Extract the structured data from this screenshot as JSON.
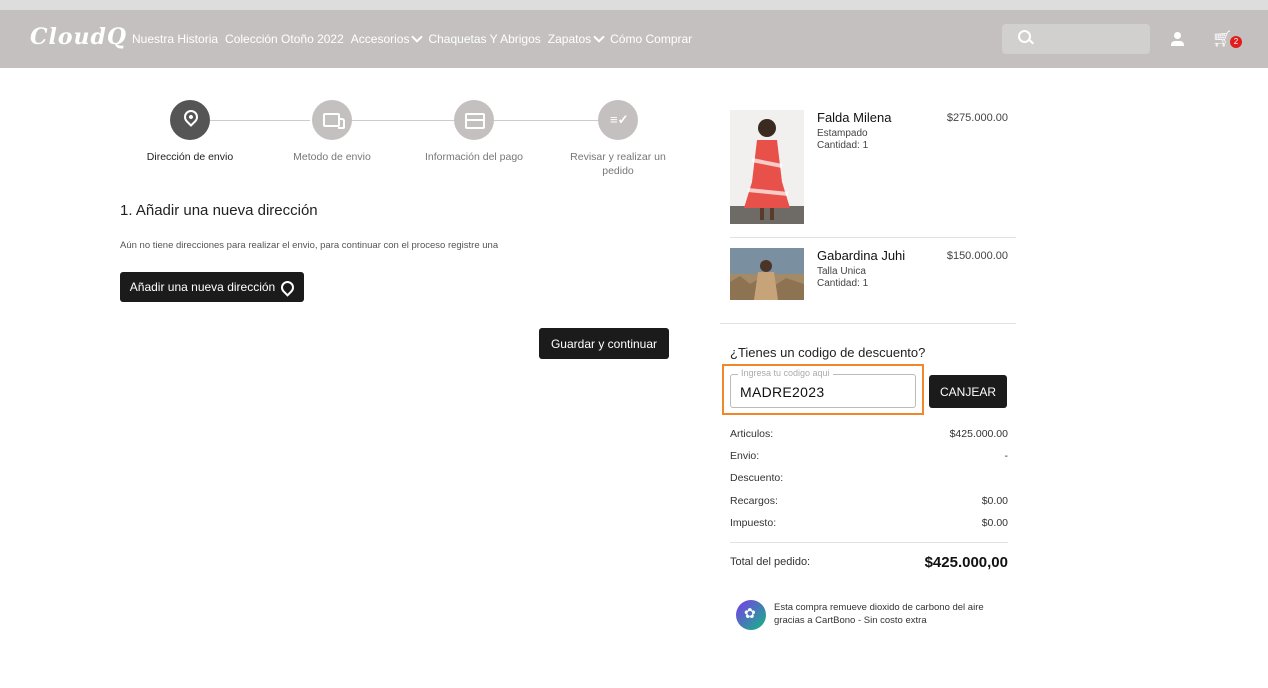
{
  "header": {
    "logo": "CloudQ",
    "nav": [
      {
        "label": "Nuestra Historia",
        "dropdown": false
      },
      {
        "label": "Colección Otoño 2022",
        "dropdown": false
      },
      {
        "label": "Accesorios",
        "dropdown": true
      },
      {
        "label": "Chaquetas Y Abrigos",
        "dropdown": false
      },
      {
        "label": "Zapatos",
        "dropdown": true
      },
      {
        "label": "Cómo Comprar",
        "dropdown": false
      }
    ],
    "cart_count": "2"
  },
  "steps": [
    {
      "label": "Dirección de envio",
      "icon": "location-pin-icon",
      "active": true
    },
    {
      "label": "Metodo de envio",
      "icon": "truck-icon",
      "active": false
    },
    {
      "label": "Información del pago",
      "icon": "credit-card-icon",
      "active": false
    },
    {
      "label": "Revisar y realizar un pedido",
      "icon": "review-list-icon",
      "active": false
    }
  ],
  "address": {
    "title": "1. Añadir una nueva dirección",
    "empty_message": "Aún no tiene direcciones para realizar el envio, para continuar con el proceso registre una",
    "add_button": "Añadir una nueva dirección",
    "save_button": "Guardar y continuar"
  },
  "cart": {
    "items": [
      {
        "name": "Falda Milena",
        "variant": "Estampado",
        "quantity": "Cantidad: 1",
        "price": "$275.000.00"
      },
      {
        "name": "Gabardina Juhi",
        "variant": "Talla Unica",
        "quantity": "Cantidad: 1",
        "price": "$150.000.00"
      }
    ],
    "discount": {
      "title": "¿Tienes un codigo de descuento?",
      "placeholder": "Ingresa tu codigo aqui",
      "value": "MADRE2023",
      "button": "CANJEAR"
    },
    "totals": [
      {
        "label": "Articulos:",
        "value": "$425.000.00"
      },
      {
        "label": "Envio:",
        "value": "-"
      },
      {
        "label": "Descuento:",
        "value": ""
      },
      {
        "label": "Recargos:",
        "value": "$0.00"
      },
      {
        "label": "Impuesto:",
        "value": "$0.00"
      }
    ],
    "order_total": {
      "label": "Total del pedido:",
      "value": "$425.000,00"
    },
    "cartbono": "Esta compra remueve dioxido de carbono del aire gracias a CartBono - Sin costo extra"
  },
  "colors": {
    "accent_outline": "#f0872a",
    "badge": "#e01c1c",
    "button": "#1b1b1b",
    "header": "#c4c0c0"
  }
}
